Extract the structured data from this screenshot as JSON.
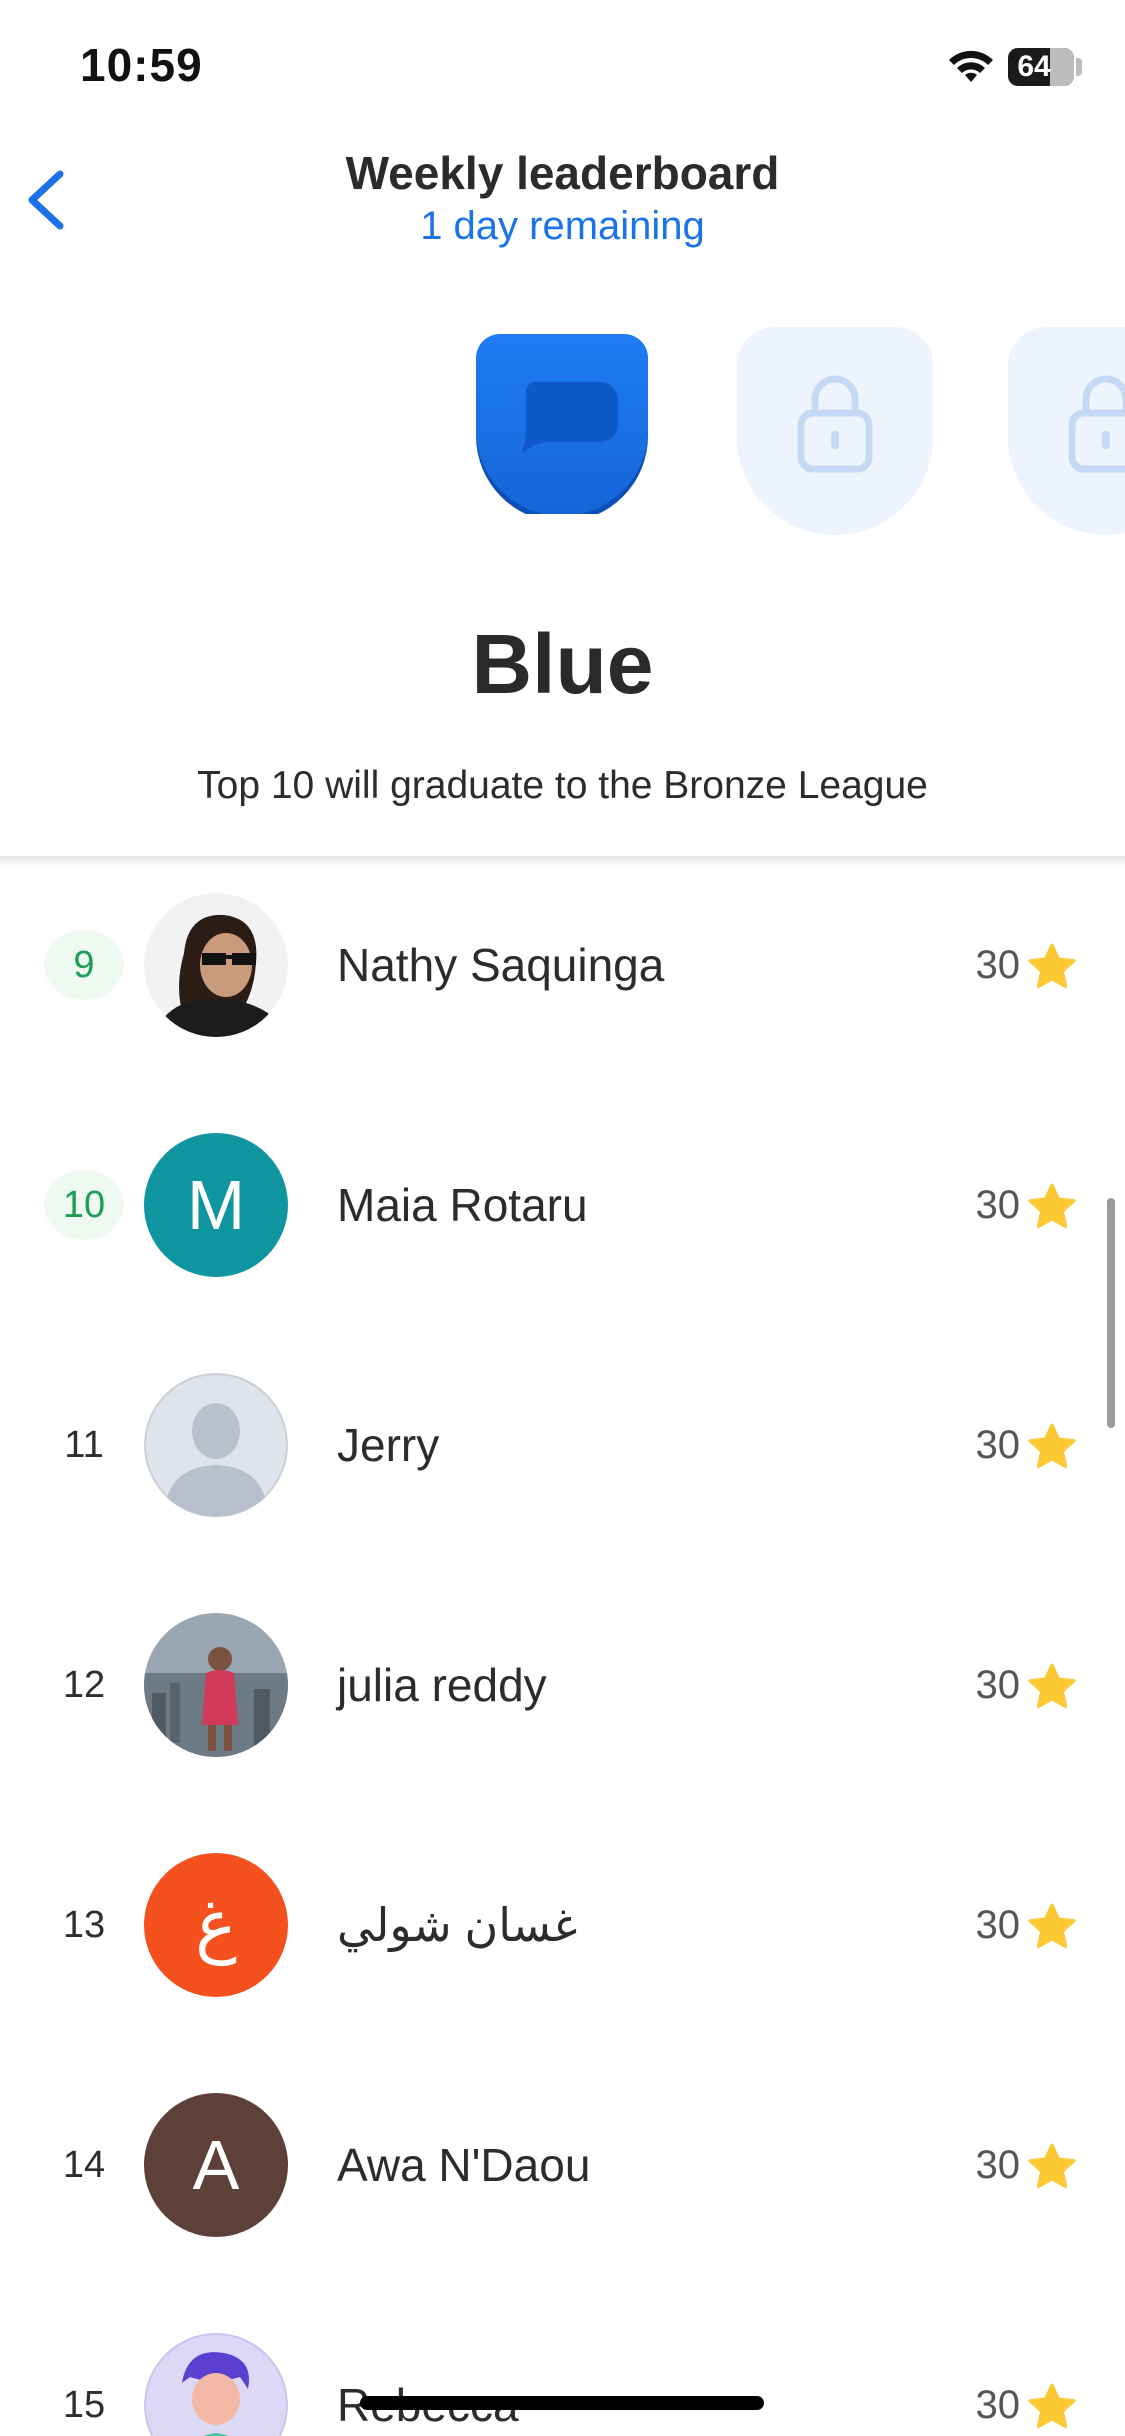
{
  "status_bar": {
    "time": "10:59",
    "battery_level": "64",
    "battery_fraction": 0.64
  },
  "nav": {
    "back_icon": "chevron-left-icon",
    "title": "Weekly leaderboard",
    "subtitle": "1 day remaining"
  },
  "league": {
    "name": "Blue",
    "info": "Top 10 will graduate to the Bronze League",
    "badges": [
      {
        "state": "active",
        "icon": "speech-bubble-icon",
        "color": "#1a73e8"
      },
      {
        "state": "locked",
        "icon": "lock-icon"
      },
      {
        "state": "locked",
        "icon": "lock-icon"
      }
    ]
  },
  "colors": {
    "accent": "#1a73e8",
    "promote_green": "#1f9d55",
    "star": "#fcc934"
  },
  "leaderboard": [
    {
      "rank": "9",
      "name": "Nathy Saquinga",
      "score": "30",
      "avatar_type": "photo",
      "promote": true
    },
    {
      "rank": "10",
      "name": "Maia Rotaru",
      "score": "30",
      "avatar_type": "letter",
      "letter": "M",
      "avatar_color": "#0e95a0",
      "promote": true
    },
    {
      "rank": "11",
      "name": "Jerry",
      "score": "30",
      "avatar_type": "placeholder",
      "promote": false
    },
    {
      "rank": "12",
      "name": "julia reddy",
      "score": "30",
      "avatar_type": "photo",
      "promote": false
    },
    {
      "rank": "13",
      "name": "غسان شولي",
      "score": "30",
      "avatar_type": "letter",
      "letter": "غ",
      "avatar_color": "#f4511e",
      "promote": false
    },
    {
      "rank": "14",
      "name": "Awa N'Daou",
      "score": "30",
      "avatar_type": "letter",
      "letter": "A",
      "avatar_color": "#5d4037",
      "promote": false
    },
    {
      "rank": "15",
      "name": "Rebecca",
      "score": "30",
      "avatar_type": "illustration",
      "promote": false
    }
  ]
}
